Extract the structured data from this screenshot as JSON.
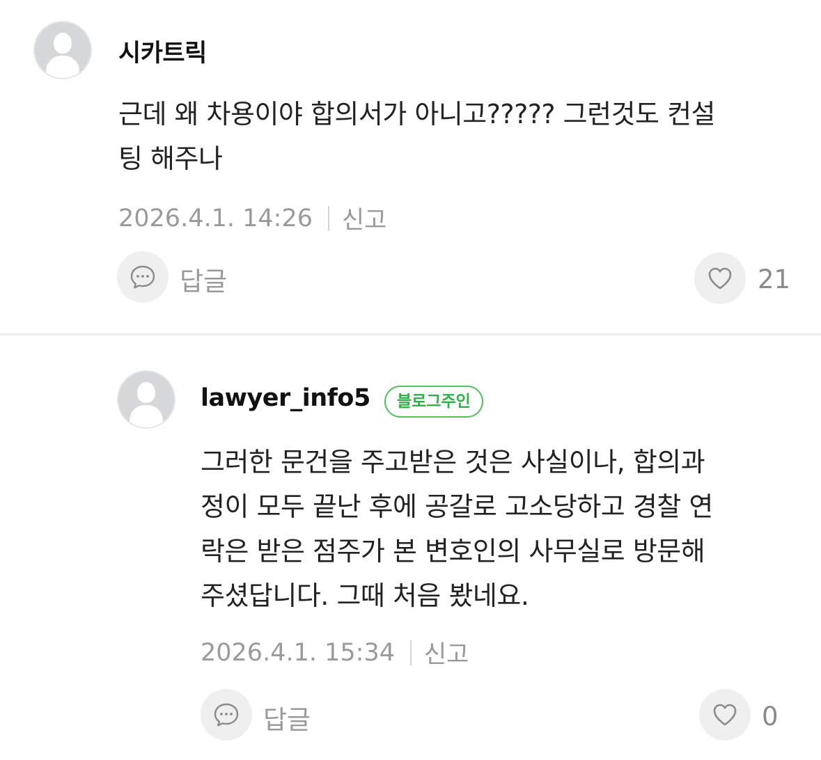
{
  "comments": [
    {
      "author": "시카트릭",
      "badge": "",
      "text_line1": "근데 왜 차용이야 합의서가 아니고????? 그런것도 컨설",
      "text_line2": "팅 해주나",
      "date": "2026.4.1. 14:26",
      "report_label": "신고",
      "reply_label": "답글",
      "like_count": "21",
      "icons": [
        "avatar-placeholder",
        "speech-bubble-icon",
        "heart-icon"
      ]
    },
    {
      "author": "lawyer_info5",
      "badge": "블로그주인",
      "text_line1": "그러한 문건을 주고받은 것은 사실이나, 합의과",
      "text_line2": "정이 모두 끝난 후에 공갈로 고소당하고 경찰 연",
      "text_line3": "락은 받은 점주가 본 변호인의 사무실로 방문해",
      "text_line4": "주셨답니다. 그때 처음 봤네요.",
      "date": "2026.4.1. 15:34",
      "report_label": "신고",
      "reply_label": "답글",
      "like_count": "0",
      "icons": [
        "avatar-placeholder",
        "speech-bubble-icon",
        "heart-icon"
      ]
    }
  ],
  "colors": {
    "badge_green": "#2fb046",
    "meta_gray": "#9a9a9a",
    "button_bg": "#efefef"
  }
}
